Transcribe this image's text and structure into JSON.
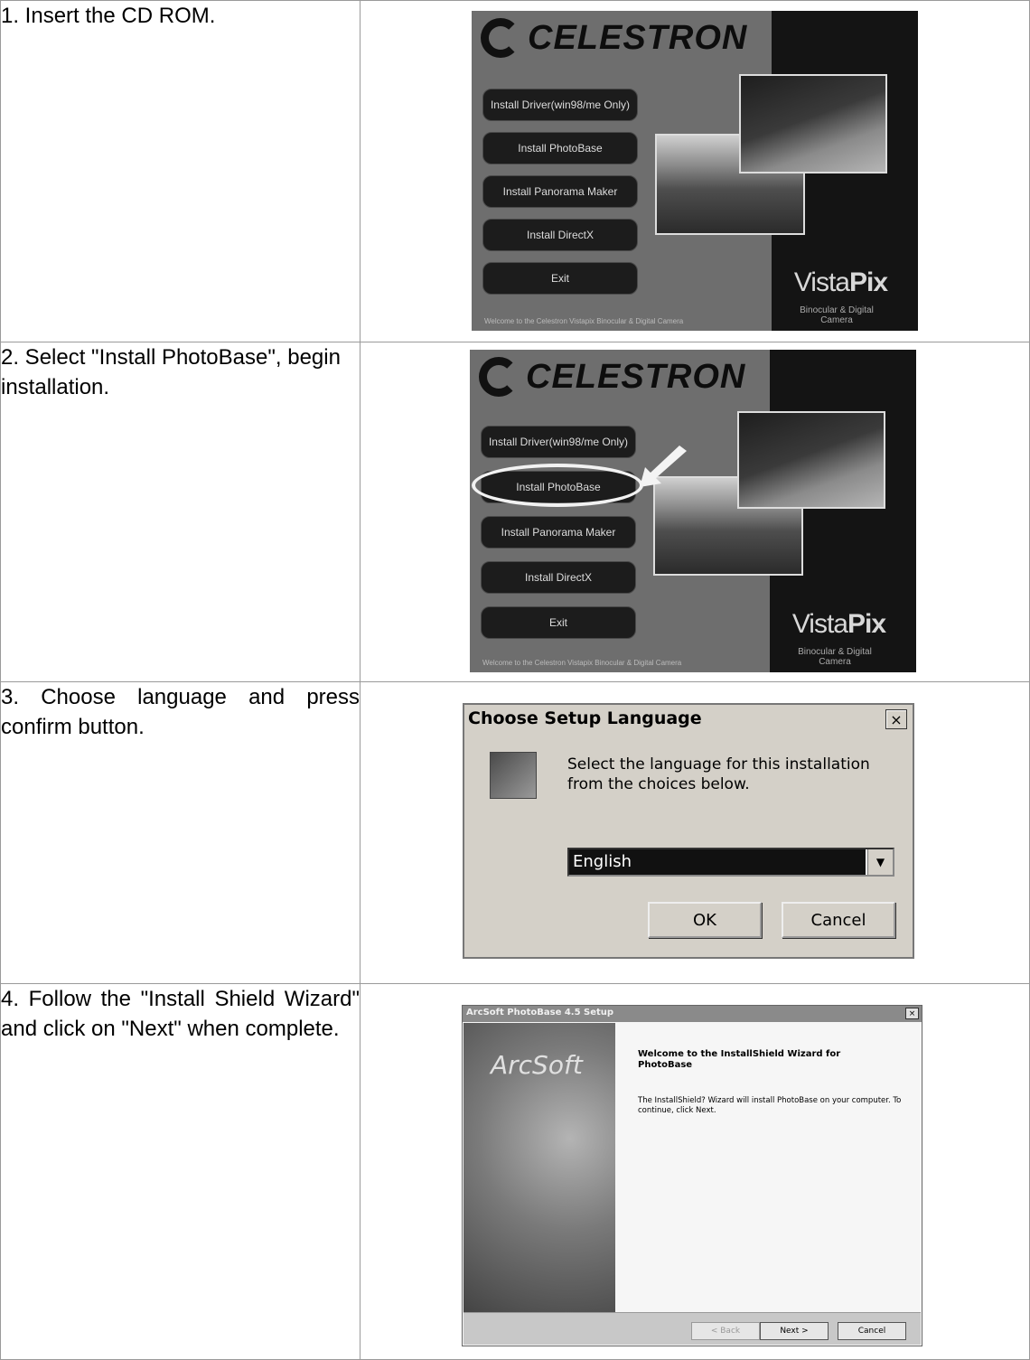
{
  "steps": [
    {
      "text": "1. Insert the CD ROM."
    },
    {
      "text": "2. Select \"Install PhotoBase\", begin installation."
    },
    {
      "text": "3. Choose language and press confirm button."
    },
    {
      "text": "4. Follow the \"Install Shield Wizard\" and click on \"Next\" when complete."
    }
  ],
  "celestron_menu": {
    "logo": "CELESTRON",
    "buttons": [
      "Install Driver(win98/me Only)",
      "Install PhotoBase",
      "Install Panorama Maker",
      "Install DirectX",
      "Exit"
    ],
    "brand_light": "Vista",
    "brand_bold": "Pix",
    "brand_sub": "Binocular & Digital Camera",
    "welcome": "Welcome to the Celestron Vistapix Binocular & Digital Camera"
  },
  "language_dialog": {
    "title": "Choose Setup Language",
    "close": "×",
    "message": "Select the language for this installation from the choices below.",
    "selected_language": "English",
    "ok": "OK",
    "cancel": "Cancel"
  },
  "wizard": {
    "title": "ArcSoft PhotoBase 4.5 Setup",
    "close": "×",
    "side_logo": "ArcSoft",
    "heading": "Welcome to the InstallShield Wizard for PhotoBase",
    "body": "The InstallShield? Wizard will install PhotoBase on your computer.  To continue, click Next.",
    "back": "< Back",
    "next": "Next >",
    "cancel": "Cancel"
  }
}
